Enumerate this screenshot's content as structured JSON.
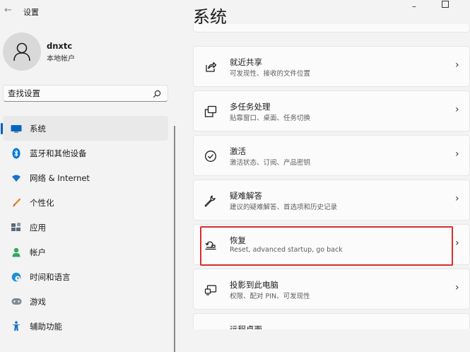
{
  "window": {
    "back_icon": "back-arrow-icon",
    "title": "设置",
    "minimize_glyph": "–",
    "maximize_glyph": "□"
  },
  "account": {
    "name": "dnxtc",
    "type": "本地帐户",
    "avatar_icon": "person-icon"
  },
  "search": {
    "placeholder": "查找设置",
    "icon": "search-icon"
  },
  "nav": {
    "items": [
      {
        "label": "系统",
        "icon": "monitor-icon",
        "color": "#0067c0",
        "active": true
      },
      {
        "label": "蓝牙和其他设备",
        "icon": "bluetooth-icon",
        "color": "#0078d4"
      },
      {
        "label": "网络 & Internet",
        "icon": "wifi-icon",
        "color": "#1a73c8"
      },
      {
        "label": "个性化",
        "icon": "brush-icon",
        "color": "#e0892c"
      },
      {
        "label": "应用",
        "icon": "apps-icon",
        "color": "#5a6b7b"
      },
      {
        "label": "帐户",
        "icon": "account-icon",
        "color": "#2eaa5c"
      },
      {
        "label": "时间和语言",
        "icon": "globe-clock-icon",
        "color": "#1a8fd6"
      },
      {
        "label": "游戏",
        "icon": "gamepad-icon",
        "color": "#7f8a94"
      },
      {
        "label": "辅助功能",
        "icon": "accessibility-icon",
        "color": "#1a73c8"
      }
    ]
  },
  "page": {
    "title": "系统"
  },
  "cards": [
    {
      "title": "就近共享",
      "subtitle": "可发现性、接收的文件位置",
      "icon": "share-icon"
    },
    {
      "title": "多任务处理",
      "subtitle": "贴靠窗口、桌面、任务切换",
      "icon": "multitasking-icon"
    },
    {
      "title": "激活",
      "subtitle": "激活状态、订阅、产品密钥",
      "icon": "check-circle-icon"
    },
    {
      "title": "疑难解答",
      "subtitle": "建议的疑难解答、首选项和历史记录",
      "icon": "wrench-icon"
    },
    {
      "title": "恢复",
      "subtitle": "Reset, advanced startup, go back",
      "icon": "recovery-icon"
    },
    {
      "title": "投影到此电脑",
      "subtitle": "权限、配对 PIN、可发现性",
      "icon": "projector-icon"
    },
    {
      "title": "远程桌面",
      "subtitle": "",
      "icon": "remote-desktop-icon"
    }
  ],
  "chevron": "›",
  "highlight_color": "#d32f2f"
}
